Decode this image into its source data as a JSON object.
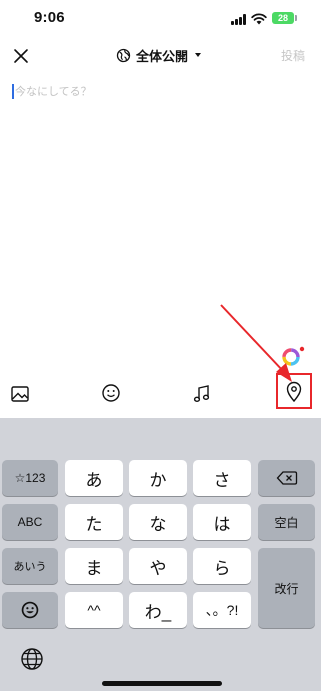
{
  "status_bar": {
    "time": "9:06",
    "battery": "28"
  },
  "header": {
    "audience": "全体公開",
    "post_label": "投稿"
  },
  "compose": {
    "placeholder": "今なにしてる？",
    "value": ""
  },
  "toolbar": {
    "icons": [
      "image-icon",
      "emoji-icon",
      "music-icon",
      "location-pin-icon",
      "color-circle-icon"
    ]
  },
  "annotation": {
    "color": "#e8272b"
  },
  "keyboard": {
    "row1": [
      "☆123",
      "あ",
      "か",
      "さ"
    ],
    "row2": [
      "ABC",
      "た",
      "な",
      "は",
      "空白"
    ],
    "row3": [
      "あいう",
      "ま",
      "や",
      "ら",
      "改行"
    ],
    "row4": [
      "^^",
      "わ_",
      "、。?!"
    ]
  },
  "colors": {
    "keyboard_bg": "#d1d3d9",
    "key_light": "#ffffff",
    "key_dark": "#acb1b9",
    "cursor": "#2f6de1"
  }
}
